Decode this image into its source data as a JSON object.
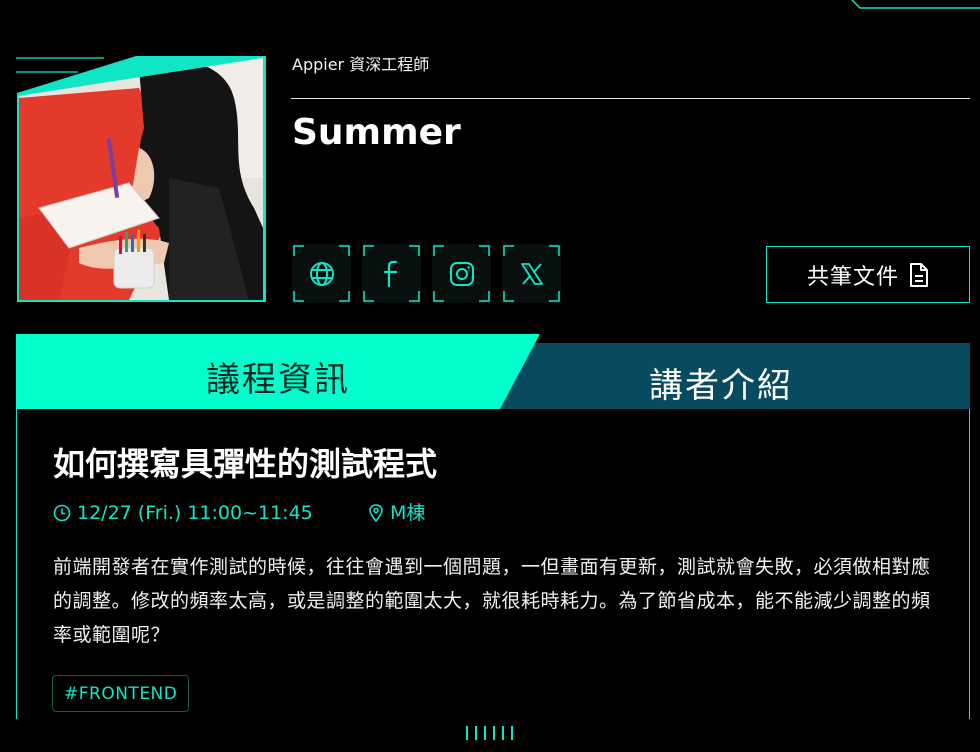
{
  "speaker": {
    "role": "Appier 資深工程師",
    "name": "Summer",
    "socials": [
      {
        "name": "website",
        "icon": "globe-icon"
      },
      {
        "name": "facebook",
        "icon": "facebook-icon"
      },
      {
        "name": "instagram",
        "icon": "instagram-icon"
      },
      {
        "name": "x",
        "icon": "x-icon"
      }
    ],
    "doc_button": {
      "label": "共筆文件",
      "icon": "document-icon"
    }
  },
  "tabs": [
    {
      "label": "議程資訊",
      "active": true
    },
    {
      "label": "講者介紹",
      "active": false
    }
  ],
  "session": {
    "title": "如何撰寫具彈性的測試程式",
    "time": "12/27 (Fri.) 11:00~11:45",
    "location": "M棟",
    "description": "前端開發者在實作測試的時候，往往會遇到一個問題，一但畫面有更新，測試就會失敗，必須做相對應的調整。修改的頻率太高，或是調整的範圍太大，就很耗時耗力。為了節省成本，能不能減少調整的頻率或範圍呢？",
    "tag": "#FRONTEND"
  },
  "colors": {
    "accent": "#10e5c6",
    "active_tab_bg": "#00ffcc",
    "inactive_tab_bg": "#084a60",
    "background": "#000000"
  }
}
